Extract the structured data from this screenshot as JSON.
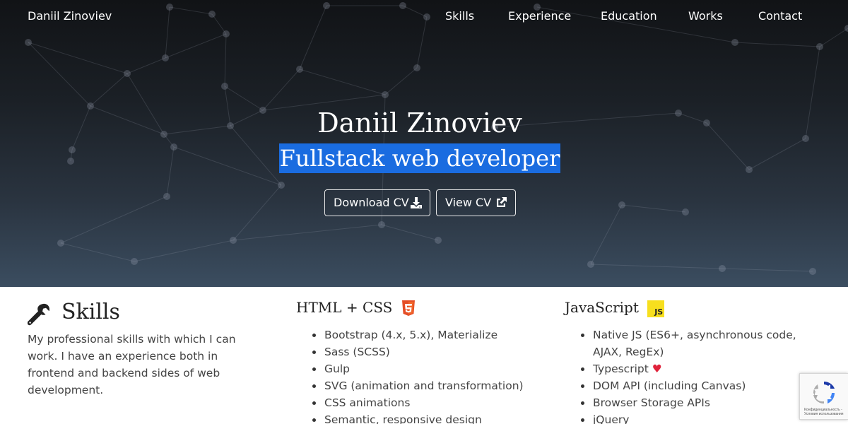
{
  "nav": {
    "brand": "Daniil Zinoviev",
    "items": [
      {
        "label": "Skills"
      },
      {
        "label": "Experience"
      },
      {
        "label": "Education"
      },
      {
        "label": "Works"
      },
      {
        "label": "Contact"
      }
    ]
  },
  "hero": {
    "title": "Daniil Zinoviev",
    "subtitle": "Fullstack web developer",
    "buttons": {
      "download": {
        "label": "Download CV",
        "icon": "download-icon"
      },
      "view": {
        "label": "View CV",
        "icon": "external-link-icon"
      }
    }
  },
  "skills": {
    "heading": "Skills",
    "icon": "wrench-icon",
    "description": "My professional skills with which I can work. I have an experience both in frontend and backend sides of web development.",
    "html_css": {
      "title": "HTML + CSS",
      "badge": "html5-icon",
      "items": [
        "Bootstrap (4.x, 5.x), Materialize",
        "Sass (SCSS)",
        "Gulp",
        "SVG (animation and transformation)",
        "CSS animations",
        "Semantic, responsive design"
      ]
    },
    "javascript": {
      "title": "JavaScript",
      "badge_text": "JS",
      "items": [
        "Native JS (ES6+, asynchronous code, AJAX, RegEx)",
        "Typescript",
        "DOM API (including Canvas)",
        "Browser Storage APIs",
        "jQuery"
      ],
      "heart": "♥"
    }
  },
  "recaptcha": {
    "text": "Конфиденциальность - Условия использования"
  },
  "colors": {
    "accent": "#1a6ce0",
    "html5": "#e44d26",
    "js_badge": "#f7df1e"
  }
}
